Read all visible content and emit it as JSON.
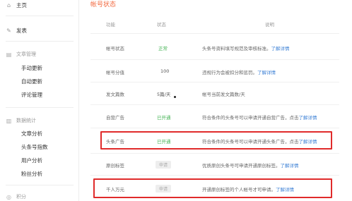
{
  "sidebar": {
    "home": {
      "label": "主页",
      "icon": "home-icon"
    },
    "publish": {
      "label": "发表",
      "icon": "edit-icon"
    },
    "content_group": {
      "label": "文章管理",
      "icon": "document-icon"
    },
    "content_items": [
      "手动更新",
      "自动更新",
      "评论管理"
    ],
    "stats_group": {
      "label": "数据统计",
      "icon": "chart-icon"
    },
    "stats_items": [
      "文章分析",
      "头条号指数",
      "用户分析",
      "粉丝分析"
    ],
    "bottom": {
      "label": "积分",
      "icon": "coin-icon"
    }
  },
  "main": {
    "title": "帐号状态",
    "headers": {
      "name": "功能",
      "status": "状态",
      "desc": "说明"
    },
    "rows": [
      {
        "name": "帐号状态",
        "status": "正常",
        "status_style": "green",
        "desc": "头条号资料填写规范及审核标准。",
        "link": "了解详情"
      },
      {
        "name": "帐号分值",
        "status": "100",
        "status_style": "gray",
        "desc": "违规行为会被扣分和惩罚。",
        "link": "了解详情"
      },
      {
        "name": "发文篇数",
        "status": "5篇/天",
        "status_style": "gray",
        "desc": "帐号当前发文篇数/天",
        "link": ""
      },
      {
        "name": "自营广告",
        "status": "已开通",
        "status_style": "green",
        "desc": "符合条件的头条号可以申请开通自营广告，点击",
        "link": "了解详情"
      },
      {
        "name": "头条广告",
        "status": "已开通",
        "status_style": "green",
        "desc": "符合条件的头条号可以申请开通头条广告，点击",
        "link": "了解详情"
      },
      {
        "name": "原创标签",
        "status": "申请",
        "status_style": "button",
        "desc": "优质原创头条号可申请开通原创标签。",
        "link": "了解详情"
      },
      {
        "name": "千人万元",
        "status": "申请",
        "status_style": "button",
        "desc": "开通原创标签的个人帐号才可申请。",
        "link": "了解详情"
      }
    ]
  },
  "colors": {
    "accent": "#f2683e",
    "green": "#46b456",
    "link": "#3a7fd5",
    "highlight": "#e02b2b"
  }
}
